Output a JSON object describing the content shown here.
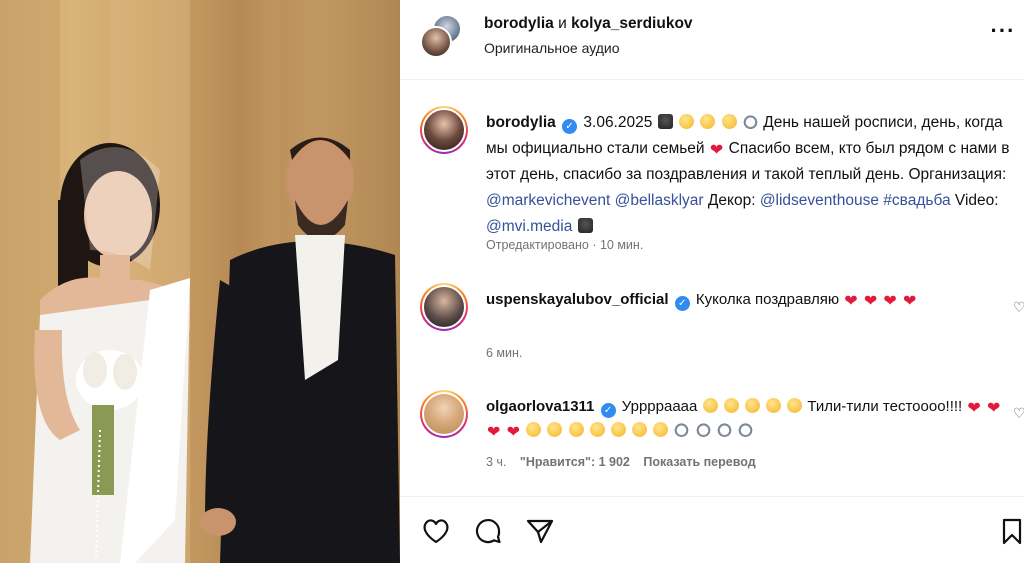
{
  "header": {
    "user1": "borodylia",
    "and": "и",
    "user2": "kolya_serdiukov",
    "audio": "Оригинальное аудио",
    "more_icon": "more-icon"
  },
  "caption": {
    "user": "borodylia",
    "date": "3.06.2025",
    "text1": "День нашей росписи, день, когда мы официально стали семьей",
    "text2": " Спасибо всем, кто был рядом с нами в этот день, спасибо за поздравления и такой теплый день. Организация: ",
    "link1": "@markevichevent",
    "link2": "@bellasklyar",
    "decor": " Декор: ",
    "link3": "@lidseventhouse",
    "hashtag": "#свадьба",
    "video": " Video: ",
    "link4": "@mvi.media",
    "meta": "Отредактировано · 10 мин."
  },
  "comments": [
    {
      "user": "uspenskayalubov_official",
      "text": "Куколка поздравляю",
      "meta": "6 мин."
    },
    {
      "user": "olgaorlova1311",
      "text1": "Урррраааа",
      "text2": " Тили-тили тестоооо!!!!",
      "meta_time": "3 ч.",
      "meta_likes": "\"Нравится\": 1 902",
      "meta_translate": "Показать перевод"
    }
  ],
  "icons": {
    "like": "heart-icon",
    "comment": "comment-icon",
    "share": "share-icon",
    "save": "bookmark-icon"
  },
  "colors": {
    "link": "#34519a",
    "verified": "#2f8cf0",
    "heart": "#e01b3c",
    "meta": "#737373"
  }
}
